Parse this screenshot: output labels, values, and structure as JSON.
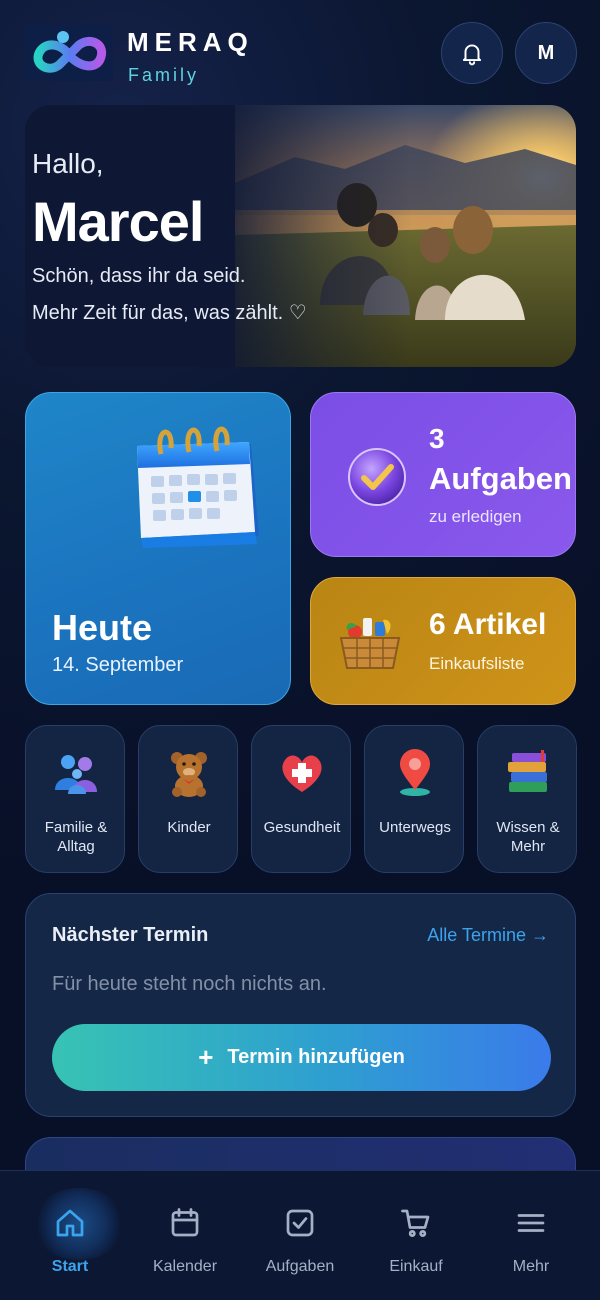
{
  "app": {
    "brand_name": "MERAQ",
    "brand_sub": "Family",
    "avatar_initial": "M"
  },
  "hero": {
    "greeting": "Hallo,",
    "name": "Marcel",
    "line1": "Schön, dass ihr da seid.",
    "line2": "Mehr Zeit für das, was zählt. ♡"
  },
  "today_card": {
    "title": "Heute",
    "date": "14. September",
    "icon": "calendar-icon"
  },
  "tasks_card": {
    "count": "3",
    "title": "Aufgaben",
    "subtitle": "zu erledigen",
    "icon": "check-badge-icon"
  },
  "shopping_card": {
    "title": "6 Artikel",
    "subtitle": "Einkaufsliste",
    "icon": "basket-icon"
  },
  "categories": [
    {
      "label": "Familie &\nAlltag",
      "icon": "family-icon"
    },
    {
      "label": "Kinder",
      "icon": "teddy-bear-icon"
    },
    {
      "label": "Gesundheit",
      "icon": "health-heart-icon"
    },
    {
      "label": "Unterwegs",
      "icon": "location-pin-icon"
    },
    {
      "label": "Wissen &\nMehr",
      "icon": "books-icon"
    }
  ],
  "next_appointment": {
    "title": "Nächster Termin",
    "link": "Alle Termine →",
    "empty_text": "Für heute steht noch nichts an.",
    "button_plus": "+",
    "button_label": "Termin hinzufügen"
  },
  "bottom_nav": [
    {
      "label": "Start",
      "icon": "home-icon",
      "active": true
    },
    {
      "label": "Kalender",
      "icon": "calendar-icon",
      "active": false
    },
    {
      "label": "Aufgaben",
      "icon": "checkbox-icon",
      "active": false
    },
    {
      "label": "Einkauf",
      "icon": "cart-icon",
      "active": false
    },
    {
      "label": "Mehr",
      "icon": "menu-icon",
      "active": false
    }
  ],
  "colors": {
    "accent": "#3aa4ee",
    "today_card": "#1f7fc6",
    "tasks_card": "#8455ea",
    "shopping_card": "#c78e17",
    "background": "#0b1630"
  }
}
